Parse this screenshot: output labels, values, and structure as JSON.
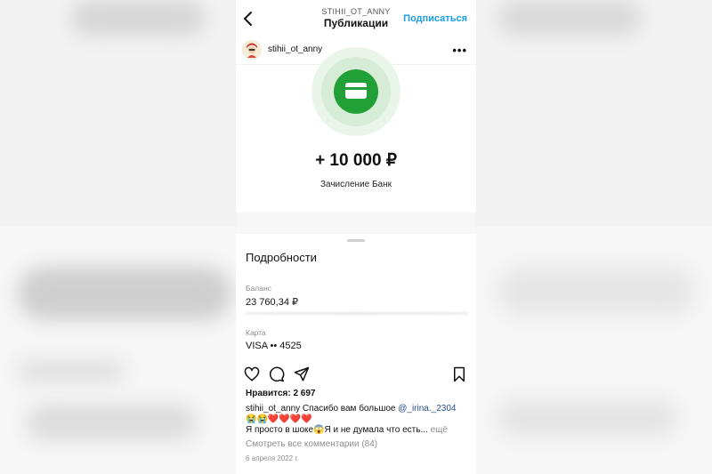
{
  "header": {
    "username": "STIHII_OT_ANNY",
    "title": "Публикации",
    "follow_label": "Подписаться",
    "back_icon": "chevron-left-icon"
  },
  "post_header": {
    "username": "stihii_ot_anny",
    "more_icon": "more-horizontal-icon",
    "more_glyph": "•••"
  },
  "post_image": {
    "icon": "credit-card-icon",
    "amount": "+ 10 000 ₽",
    "operation": "Зачисление Банк",
    "details_title": "Подробности",
    "balance_label": "Баланс",
    "balance_value": "23 760,34 ₽",
    "card_label": "Карта",
    "card_value": "VISA •• 4525",
    "accent_color": "#21a038"
  },
  "actions": {
    "like_icon": "heart-icon",
    "comment_icon": "comment-icon",
    "share_icon": "send-icon",
    "save_icon": "bookmark-icon"
  },
  "likes_text": "Нравится: 2 697",
  "caption": {
    "username": "stihii_ot_anny",
    "text": " Спасибо вам большое ",
    "mention": "@_irina._2304",
    "emoji_line": "😭😭❤️❤️❤️❤️",
    "line3": "Я просто в шоке😱Я и не думала что есть... ",
    "more_label": "ещё"
  },
  "view_comments_label": "Смотреть все комментарии (84)",
  "post_date": "6 апреля 2022 г.",
  "colors": {
    "link_blue": "#1a9de6",
    "mention_blue": "#234f8c",
    "muted_gray": "#8e8e8e"
  }
}
